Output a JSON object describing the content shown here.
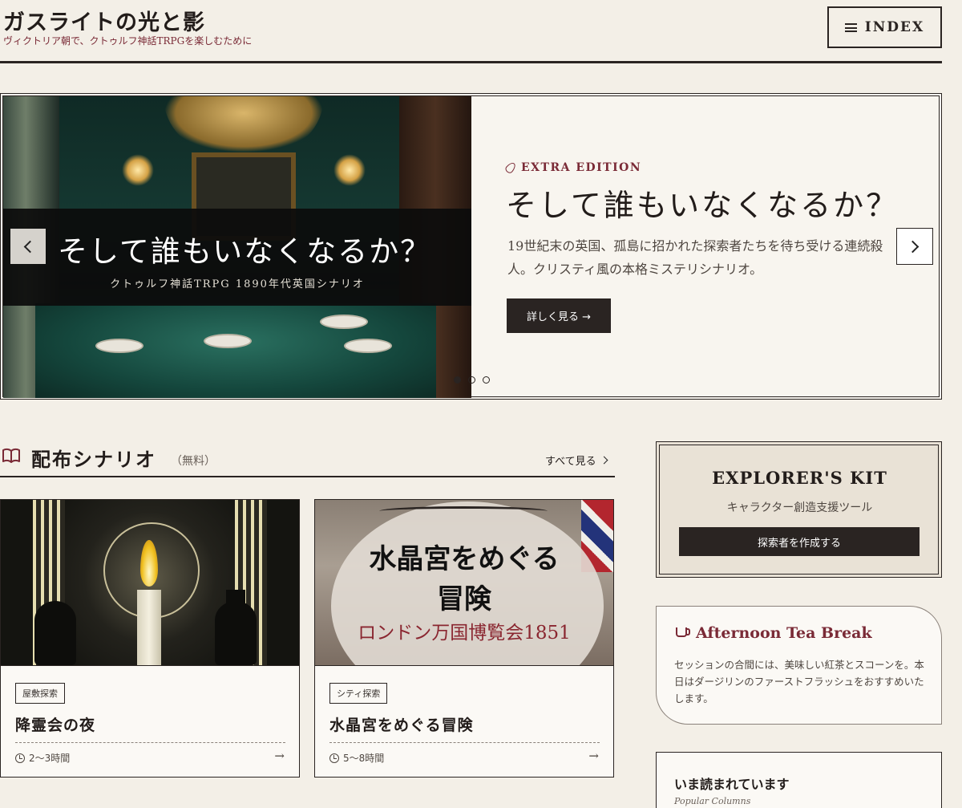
{
  "header": {
    "site_title": "ガスライトの光と影",
    "tagline": "ヴィクトリア朝で、クトゥルフ神話TRPGを楽しむために",
    "index_label": "INDEX"
  },
  "hero": {
    "image_title": "そして誰もいなくなるか？",
    "image_subtitle": "クトゥルフ神話TRPG 1890年代英国シナリオ",
    "edition_label": "EXTRA EDITION",
    "title": "そして誰もいなくなるか？",
    "description": "19世紀末の英国、孤島に招かれた探索者たちを待ち受ける連続殺人。クリスティ風の本格ミステリシナリオ。",
    "button_label": "詳しく見る →",
    "slides_total": 3,
    "active_slide": 1
  },
  "scenarios": {
    "title": "配布シナリオ",
    "note": "（無料）",
    "see_all": "すべて見る",
    "cards": [
      {
        "tag": "屋敷探索",
        "title": "降霊会の夜",
        "duration": "2〜3時間",
        "arrow": "→"
      },
      {
        "tag": "シティ探索",
        "title": "水晶宮をめぐる冒険",
        "duration": "5〜8時間",
        "arrow": "→",
        "image_text": {
          "line1": "水晶宮をめぐる",
          "line2": "冒険",
          "line3": "ロンドン万国博覧会1851"
        }
      }
    ]
  },
  "sidebar": {
    "kit": {
      "title": "EXPLORER'S KIT",
      "subtitle": "キャラクター創造支援ツール",
      "button_label": "探索者を作成する"
    },
    "tea": {
      "title": "Afternoon Tea Break",
      "text": "セッションの合間には、美味しい紅茶とスコーンを。本日はダージリンのファーストフラッシュをおすすめいたします。"
    },
    "popular": {
      "title": "いま読まれています",
      "subtitle": "Popular Columns"
    }
  },
  "icons": {
    "menu": "hamburger-icon",
    "edition": "feather-icon",
    "section": "book-icon",
    "clock": "clock-icon",
    "tea": "teacup-icon"
  },
  "colors": {
    "background": "#f3efe7",
    "ink": "#2a2422",
    "accent": "#7a2a36"
  }
}
